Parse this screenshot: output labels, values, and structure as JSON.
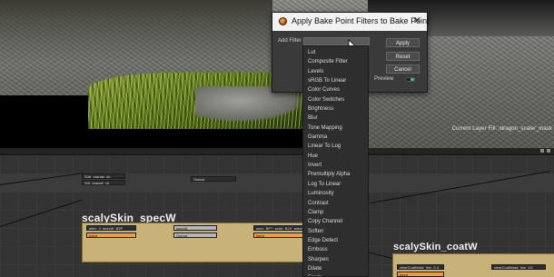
{
  "viewport": {
    "overlay_text": "Current Layer Fill: /dragon_scale/_mask"
  },
  "dialog": {
    "title": "Apply Bake Point Filters to Bake Point",
    "close_glyph": "✕",
    "add_filter_label": "Add Filter",
    "buttons": {
      "apply": "Apply",
      "reset": "Reset",
      "cancel": "Cancel"
    },
    "preview_label": "Preview",
    "preview_on": true
  },
  "filter_options": [
    "Lut",
    "Composite Filter",
    "Levels",
    "sRGB To Linear",
    "Color Curves",
    "Color Switches",
    "Brightness",
    "Blur",
    "Tone Mapping",
    "Gamma",
    "Linear To Log",
    "Hue",
    "Invert",
    "Premultiply Alpha",
    "Log To Linear",
    "Luminosity",
    "Contrast",
    "Clamp",
    "Copy Channel",
    "Soften",
    "Edge Detect",
    "Emboss",
    "Sharpen",
    "Dilate",
    "Erode"
  ],
  "graph": {
    "groups": {
      "spec": "scalySkin_specW",
      "coat": "scalySkin_coatW"
    },
    "nodes": {
      "n1": "S/dr_orange_ch",
      "n2": "S/d_orange_ch",
      "n3": "Output",
      "n4": "alien_0_specW_B2P",
      "n5": "specW",
      "n6": "spec_BP?_scaly_B2V_specW",
      "n7": "Input",
      "n8": "Output",
      "n9": "input",
      "n10": "Input",
      "n11": "clearCoatMask_line_0.4",
      "n12": "clearCoatMask_line_4G"
    }
  }
}
